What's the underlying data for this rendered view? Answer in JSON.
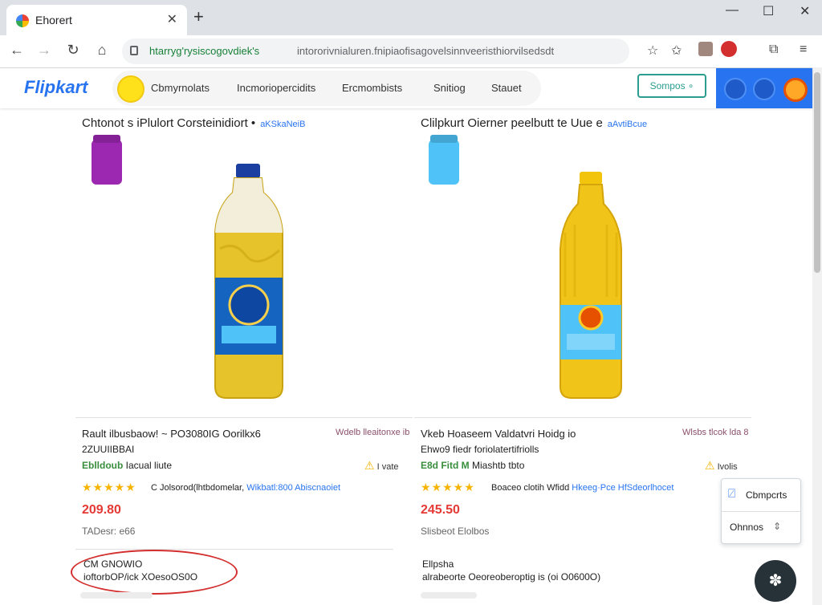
{
  "browser": {
    "tab_title": "Ehorert",
    "tab_close": "✕",
    "new_tab": "+",
    "win_min": "—",
    "win_max": "☐",
    "win_close": "✕",
    "url_host": "htarryg'rysiscogovdiek's",
    "url_path": "intororivnialuren.fnipiaofisagovelsinnveeristhiorvilsedsdt"
  },
  "site": {
    "logo": "Flipkart",
    "nav": [
      "Cbmyrnolats",
      "Incmoriopercidits",
      "Ercmombists",
      "Snitiog",
      "Stauet"
    ],
    "compare_button": "Sompos ∘"
  },
  "products": [
    {
      "title": "Chtonot s iPlulort Corsteinidiort •",
      "title_sub": "aKSkaNeiB",
      "jar_color": "#9c27b0",
      "name": "Rault ilbusbaow! ~ PO3080IG Oorilkx6",
      "right_label": "Wdelb lleaitonxe ib",
      "line2": "2ZUUIIBBAI",
      "line3_green": "Eblldoub",
      "line3_rest": "Iacual liute",
      "warn_text": "I vate",
      "stars": "★★★★★",
      "stars_text_a": "C Jolsorod(lhtbdomelar,",
      "stars_text_b": "Wikbatl:800 Abiscnaoiet",
      "price": "209.80",
      "detail": "TADesr: e66",
      "bottom1": "CM GNOWIO",
      "bottom2": "ioftorbOP/ick XOesoOS0O"
    },
    {
      "title": "Clilpkurt Oierner peelbutt te Uue e",
      "title_sub": "aAvtiBcue",
      "jar_color": "#29b6f6",
      "name": "Vkeb Hoaseem Valdatvri Hoidg io",
      "right_label": "Wlsbs tlcok lda 8",
      "line2": "Ehwo9 fiedr foriolatertifriolls",
      "line3_green": "E8d Fitd M",
      "line3_rest": "Miashtb tbto",
      "warn_text": "Ivolis",
      "stars": "★★★★★",
      "stars_text_a": "Boaceo clotih Wfidd",
      "stars_text_b": "Hkeeg·Pce HfSdeorlhocet",
      "price": "245.50",
      "detail": "Slisbeot Elolbos",
      "bottom1": "Ellpsha",
      "bottom2": "alrabeorte Oeoreoberoptig is (oi O0600O)"
    }
  ],
  "popup": {
    "compare": "Cbmpcrts",
    "options": "Ohnnos",
    "options_arrow": "⇕"
  },
  "colors": {
    "accent": "#2874f0",
    "price": "#e53935",
    "rating": "#f6b400",
    "stock_green": "#388e3c",
    "annotation": "#d32f2f"
  }
}
